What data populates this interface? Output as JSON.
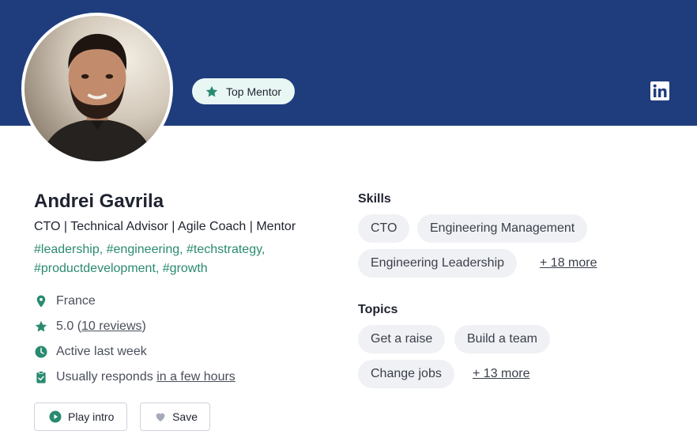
{
  "badge": {
    "label": "Top Mentor",
    "icon": "star-icon"
  },
  "social": {
    "icon": "linkedin-icon"
  },
  "profile": {
    "name": "Andrei Gavrila",
    "headline": "CTO | Technical Advisor | Agile Coach | Mentor",
    "hashtags": "#leadership, #engineering, #techstrategy, #productdevelopment, #growth"
  },
  "meta": {
    "location": "France",
    "rating": "5.0",
    "rating_open": "(",
    "reviews": "10 reviews",
    "rating_close": ")",
    "active": "Active last week",
    "responds_prefix": "Usually responds",
    "responds_link": "in a few hours"
  },
  "actions": {
    "play_label": "Play intro",
    "save_label": "Save"
  },
  "skills": {
    "title": "Skills",
    "items": [
      "CTO",
      "Engineering Management",
      "Engineering Leadership"
    ],
    "more": "+ 18 more"
  },
  "topics": {
    "title": "Topics",
    "items": [
      "Get a raise",
      "Build a team",
      "Change jobs"
    ],
    "more": "+ 13 more"
  },
  "colors": {
    "banner": "#1f3d7d",
    "accent": "#2a8a70",
    "chip_bg": "#f0f1f4"
  }
}
